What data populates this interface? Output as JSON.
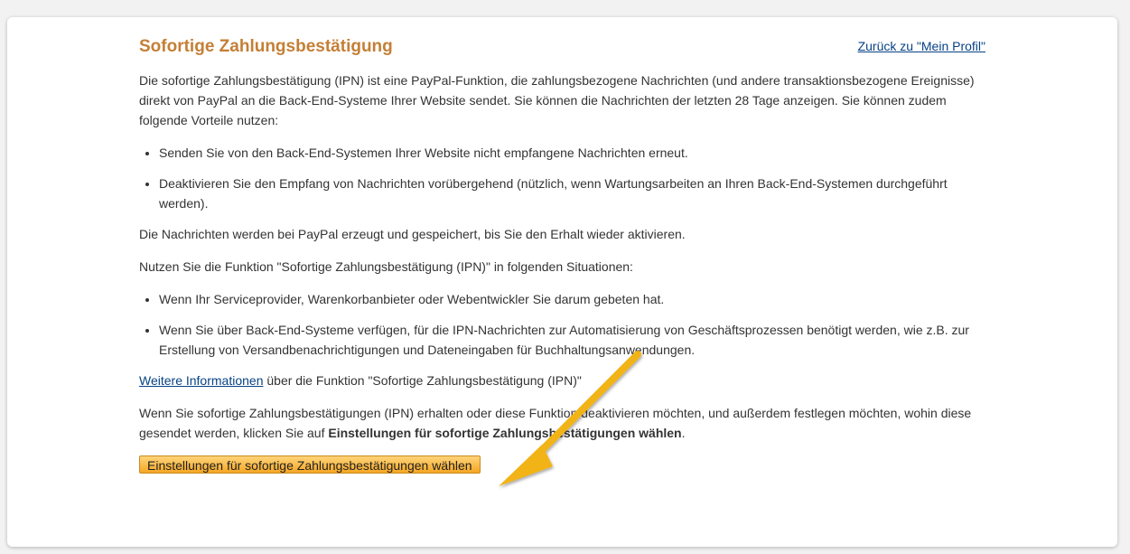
{
  "page": {
    "title": "Sofortige Zahlungsbestätigung",
    "back_link": "Zurück zu \"Mein Profil\"",
    "intro": "Die sofortige Zahlungsbestätigung (IPN) ist eine PayPal-Funktion, die zahlungsbezogene Nachrichten (und andere transaktionsbezogene Ereignisse) direkt von PayPal an die Back-End-Systeme Ihrer Website sendet. Sie können die Nachrichten der letzten 28 Tage anzeigen. Sie können zudem folgende Vorteile nutzen:",
    "benefits": [
      "Senden Sie von den Back-End-Systemen Ihrer Website nicht empfangene Nachrichten erneut.",
      "Deaktivieren Sie den Empfang von Nachrichten vorübergehend (nützlich, wenn Wartungsarbeiten an Ihren Back-End-Systemen durchgeführt werden)."
    ],
    "storage_note": "Die Nachrichten werden bei PayPal erzeugt und gespeichert, bis Sie den Erhalt wieder aktivieren.",
    "use_intro": "Nutzen Sie die Funktion \"Sofortige Zahlungsbestätigung (IPN)\" in folgenden Situationen:",
    "situations": [
      "Wenn Ihr Serviceprovider, Warenkorbanbieter oder Webentwickler Sie darum gebeten hat.",
      "Wenn Sie über Back-End-Systeme verfügen, für die IPN-Nachrichten zur Automatisierung von Geschäftsprozessen benötigt werden, wie z.B. zur Erstellung von Versandbenachrichtigungen und Dateneingaben für Buchhaltungsanwendungen."
    ],
    "more_link": "Weitere Informationen",
    "more_suffix": " über die Funktion \"Sofortige Zahlungsbestätigung (IPN)\"",
    "wenn_prefix": "Wenn Sie sofortige Zahlungsbestätigungen (IPN) erhalten oder diese Funktion deaktivieren möchten, und außerdem festlegen möchten, wohin diese gesendet werden, klicken Sie auf ",
    "wenn_bold": "Einstellungen für sofortige Zahlungsbestätigungen wählen",
    "wenn_suffix": ".",
    "button_label": "Einstellungen für sofortige Zahlungsbestätigungen wählen"
  },
  "colors": {
    "title": "#c47f36",
    "link": "#084285",
    "arrow": "#f2b319",
    "button": "#f5a623"
  }
}
